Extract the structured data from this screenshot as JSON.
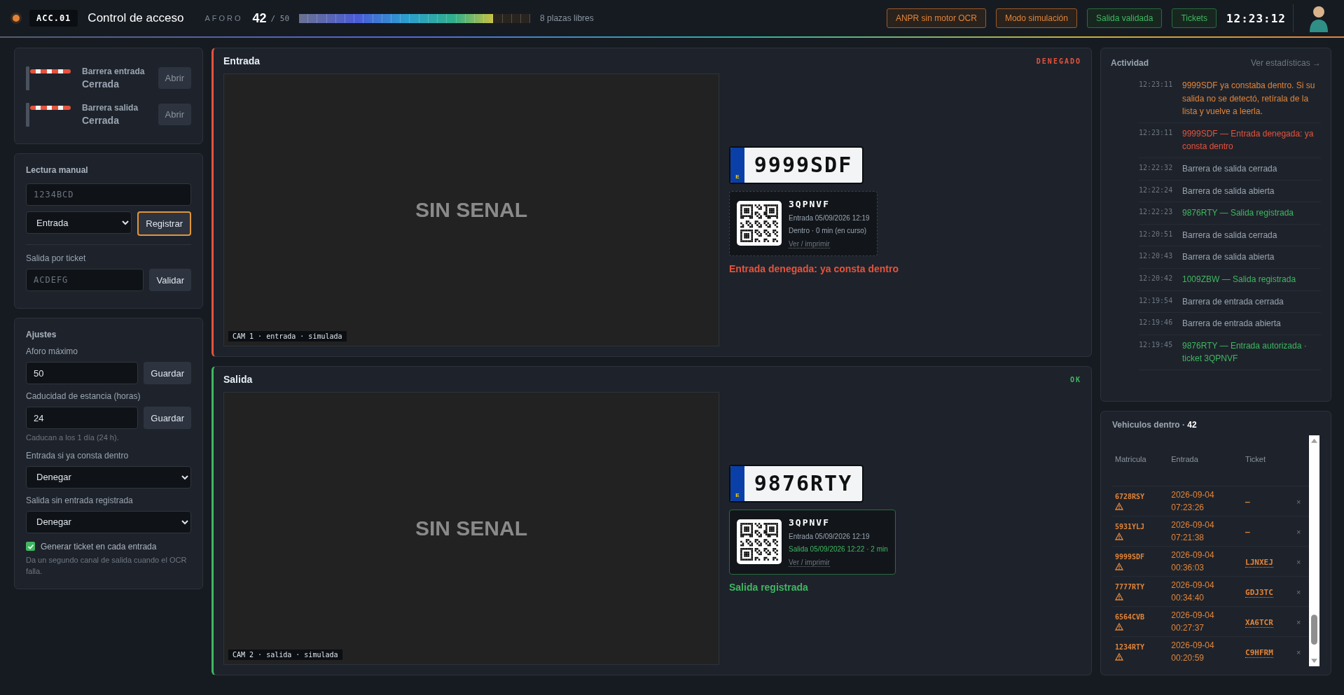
{
  "header": {
    "code": "ACC.01",
    "title": "Control de acceso",
    "capacity_label": "AFORO",
    "occupied": "42",
    "capacity": "/ 50",
    "level": 0.84,
    "free": "8 plazas libres",
    "badges": [
      {
        "label": "ANPR sin motor OCR",
        "kind": "warning"
      },
      {
        "label": "Modo simulación",
        "kind": "warning"
      },
      {
        "label": "Salida validada",
        "kind": "success"
      },
      {
        "label": "Tickets",
        "kind": "success"
      }
    ],
    "clock": "12:23:12"
  },
  "barriers": [
    {
      "name": "Barrera entrada",
      "state": "Cerrada",
      "button": "Abrir"
    },
    {
      "name": "Barrera salida",
      "state": "Cerrada",
      "button": "Abrir"
    }
  ],
  "manual": {
    "title": "Lectura manual",
    "plate_placeholder": "1234BCD",
    "direction": "Entrada",
    "register": "Registrar",
    "ticket_label": "Salida por ticket",
    "ticket_placeholder": "ACDEFG",
    "validate": "Validar"
  },
  "settings": {
    "title": "Ajustes",
    "fields": [
      {
        "label": "Aforo máximo",
        "value": "50",
        "button": "Guardar"
      },
      {
        "label": "Caducidad de estancia (horas)",
        "value": "24",
        "button": "Guardar",
        "hint": "Caducan a los 1 día (24 h)."
      }
    ],
    "selects": [
      {
        "label": "Entrada si ya consta dentro",
        "value": "Denegar"
      },
      {
        "label": "Salida sin entrada registrada",
        "value": "Denegar"
      }
    ],
    "checkbox": {
      "label": "Generar ticket en cada entrada",
      "checked": true,
      "hint": "Da un segundo canal de salida cuando el OCR falla."
    }
  },
  "lanes": [
    {
      "title": "Entrada",
      "status": "DENEGADO",
      "kind": "denied",
      "no_signal": "SIN SENAL",
      "camera": "CAM 1 · entrada · simulada",
      "plate_country": "E",
      "plate": "9999SDF",
      "ticket": {
        "code": "3QPNVF",
        "lines": [
          {
            "text": "Entrada 05/09/2026 12:19",
            "kind": "normal"
          },
          {
            "text": "Dentro · 0 min (en curso)",
            "kind": "normal"
          }
        ],
        "link": "Ver / imprimir"
      },
      "result": "Entrada denegada: ya consta dentro"
    },
    {
      "title": "Salida",
      "status": "OK",
      "kind": "ok",
      "no_signal": "SIN SENAL",
      "camera": "CAM 2 · salida · simulada",
      "plate_country": "E",
      "plate": "9876RTY",
      "ticket": {
        "code": "3QPNVF",
        "lines": [
          {
            "text": "Entrada 05/09/2026 12:19",
            "kind": "normal"
          },
          {
            "text": "Salida 05/09/2026 12:22 · 2 min",
            "kind": "success"
          }
        ],
        "link": "Ver / imprimir"
      },
      "result": "Salida registrada"
    }
  ],
  "activity": {
    "title": "Actividad",
    "link": "Ver estadísticas →",
    "items": [
      {
        "time": "12:23:11",
        "text": "9999SDF ya constaba dentro. Si su salida no se detectó, retírala de la lista y vuelve a leerla.",
        "kind": "warning"
      },
      {
        "time": "12:23:11",
        "text": "9999SDF — Entrada denegada: ya consta dentro",
        "kind": "error"
      },
      {
        "time": "12:22:32",
        "text": "Barrera de salida cerrada",
        "kind": "normal"
      },
      {
        "time": "12:22:24",
        "text": "Barrera de salida abierta",
        "kind": "normal"
      },
      {
        "time": "12:22:23",
        "text": "9876RTY — Salida registrada",
        "kind": "success"
      },
      {
        "time": "12:20:51",
        "text": "Barrera de salida cerrada",
        "kind": "normal"
      },
      {
        "time": "12:20:43",
        "text": "Barrera de salida abierta",
        "kind": "normal"
      },
      {
        "time": "12:20:42",
        "text": "1009ZBW — Salida registrada",
        "kind": "success"
      },
      {
        "time": "12:19:54",
        "text": "Barrera de entrada cerrada",
        "kind": "normal"
      },
      {
        "time": "12:19:46",
        "text": "Barrera de entrada abierta",
        "kind": "normal"
      },
      {
        "time": "12:19:45",
        "text": "9876RTY — Entrada autorizada · ticket 3QPNVF",
        "kind": "success"
      }
    ]
  },
  "vehicles": {
    "title": "Vehiculos dentro ·",
    "count": "42",
    "columns": [
      "Matricula",
      "Entrada",
      "Ticket"
    ],
    "rows": [
      {
        "plate": "6728RSY",
        "date": "2026-09-04",
        "time": "07:23:26",
        "ticket": "—",
        "ticket_link": false,
        "remove": "×"
      },
      {
        "plate": "5931YLJ",
        "date": "2026-09-04",
        "time": "07:21:38",
        "ticket": "—",
        "ticket_link": false,
        "remove": "×"
      },
      {
        "plate": "9999SDF",
        "date": "2026-09-04",
        "time": "00:36:03",
        "ticket": "LJNXEJ",
        "ticket_link": true,
        "remove": "×"
      },
      {
        "plate": "7777RTY",
        "date": "2026-09-04",
        "time": "00:34:40",
        "ticket": "GDJ3TC",
        "ticket_link": true,
        "remove": "×"
      },
      {
        "plate": "6564CVB",
        "date": "2026-09-04",
        "time": "00:27:37",
        "ticket": "XA6TCR",
        "ticket_link": true,
        "remove": "×"
      },
      {
        "plate": "1234RTY",
        "date": "2026-09-04",
        "time": "00:20:59",
        "ticket": "C9HFRM",
        "ticket_link": true,
        "remove": "×"
      }
    ]
  }
}
